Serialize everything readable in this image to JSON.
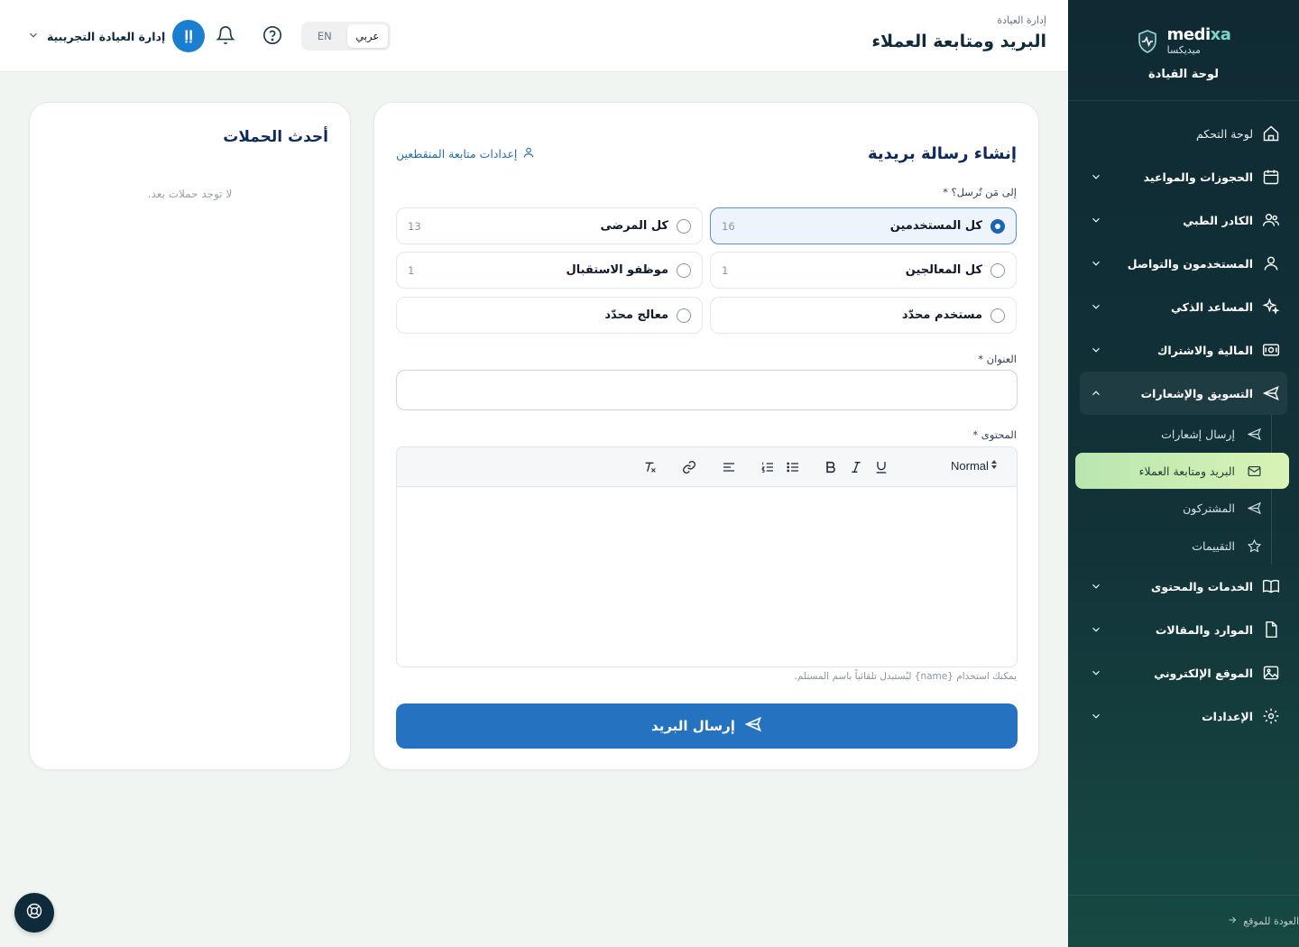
{
  "sidebar": {
    "brand_en_main": "medi",
    "brand_en_accent": "xa",
    "brand_ar": "ميديكسا",
    "subtitle": "لوحة القيادة",
    "items": [
      {
        "label": "لوحة التحكم",
        "icon": "home-icon"
      },
      {
        "label": "الحجوزات والمواعيد",
        "icon": "calendar-icon"
      },
      {
        "label": "الكادر الطبي",
        "icon": "users-icon"
      },
      {
        "label": "المستخدمون والتواصل",
        "icon": "user-icon"
      },
      {
        "label": "المساعد الذكي",
        "icon": "sparkles-icon"
      },
      {
        "label": "المالية والاشتراك",
        "icon": "money-icon"
      },
      {
        "label": "التسويق والإشعارات",
        "icon": "send-icon"
      },
      {
        "label": "الخدمات والمحتوى",
        "icon": "book-icon"
      },
      {
        "label": "الموارد والمقالات",
        "icon": "file-icon"
      },
      {
        "label": "الموقع الإلكتروني",
        "icon": "image-icon"
      },
      {
        "label": "الإعدادات",
        "icon": "gear-icon"
      }
    ],
    "marketing_sub": [
      {
        "label": "إرسال إشعارات",
        "icon": "send-icon"
      },
      {
        "label": "البريد ومتابعة العملاء",
        "icon": "mail-icon"
      },
      {
        "label": "المشتركون",
        "icon": "send-icon"
      },
      {
        "label": "التقييمات",
        "icon": "star-icon"
      }
    ],
    "back_link": "العودة للموقع"
  },
  "header": {
    "breadcrumb": "إدارة العيادة",
    "title": "البريد ومتابعة العملاء",
    "lang_ar": "عربي",
    "lang_en": "EN",
    "user_initials": "إإ",
    "user_name": "إدارة العيادة التجريبية"
  },
  "campaigns": {
    "title": "أحدث الحملات",
    "empty": "لا توجد حملات بعد."
  },
  "compose": {
    "title": "إنشاء رسالة بريدية",
    "unsub_link": "إعدادات متابعة المنقطعين",
    "recipients_label": "إلى مَن تُرسل؟ *",
    "recipients": [
      {
        "label": "كل المستخدمين",
        "count": "16",
        "selected": true
      },
      {
        "label": "كل المرضى",
        "count": "13",
        "selected": false
      },
      {
        "label": "كل المعالجين",
        "count": "1",
        "selected": false
      },
      {
        "label": "موظفو الاستقبال",
        "count": "1",
        "selected": false
      },
      {
        "label": "مستخدم محدّد",
        "count": "",
        "selected": false
      },
      {
        "label": "معالج محدّد",
        "count": "",
        "selected": false
      }
    ],
    "subject_label": "العنوان *",
    "subject_value": "",
    "content_label": "المحتوى *",
    "format_select": "Normal",
    "hint": "يمكنك استخدام {name} ليُستبدل تلقائياً باسم المستلم.",
    "send_label": "إرسال البريد"
  },
  "colors": {
    "sidebar_bg": "#0f2a33",
    "primary": "#2472c0",
    "active_sub": "#c9edb3",
    "avatar": "#1a7fd1"
  }
}
